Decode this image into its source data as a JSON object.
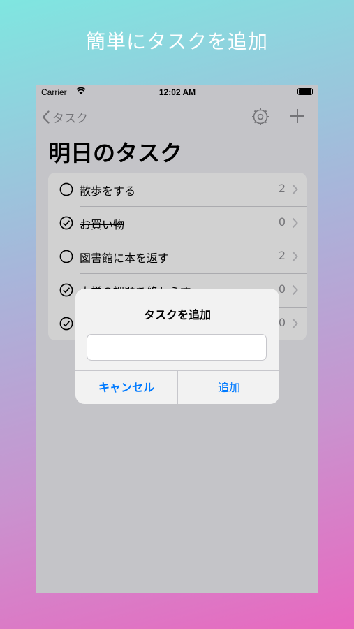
{
  "headline": "簡単にタスクを追加",
  "status_bar": {
    "carrier": "Carrier",
    "time": "12:02 AM"
  },
  "nav": {
    "back_label": "タスク"
  },
  "page_title": "明日のタスク",
  "tasks": [
    {
      "label": "散歩をする",
      "count": "2",
      "done": false
    },
    {
      "label": "お買い物",
      "count": "0",
      "done": true
    },
    {
      "label": "図書館に本を返す",
      "count": "2",
      "done": false
    },
    {
      "label": "大学の課題を終わらす",
      "count": "0",
      "done": true
    },
    {
      "label": "",
      "count": "0",
      "done": true
    }
  ],
  "dialog": {
    "title": "タスクを追加",
    "input_value": "",
    "cancel_label": "キャンセル",
    "add_label": "追加"
  },
  "colors": {
    "accent": "#007aff",
    "secondary_text": "#8e8e93"
  }
}
